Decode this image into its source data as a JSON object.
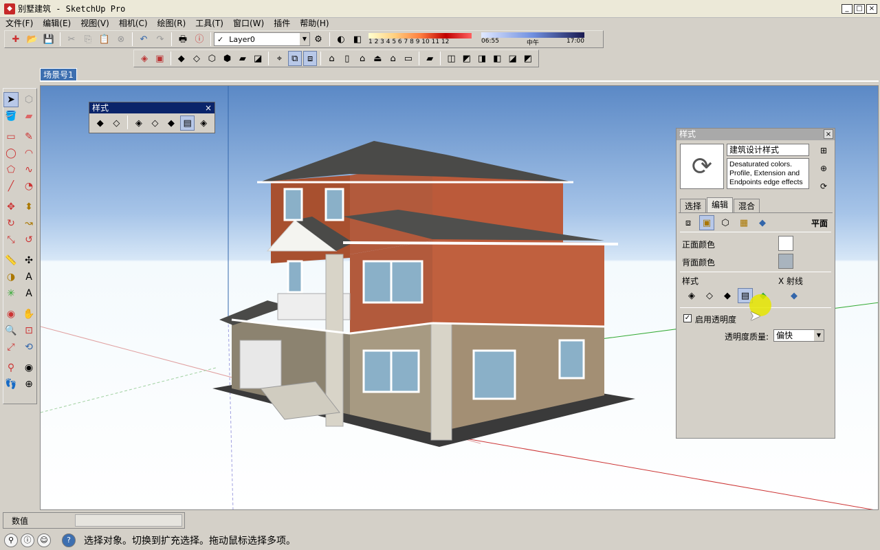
{
  "window": {
    "title": "别墅建筑 - SketchUp Pro",
    "app_icon": "sketchup-icon",
    "controls": {
      "minimize": "_",
      "maximize": "□",
      "close": "×"
    }
  },
  "menu": [
    "文件(F)",
    "编辑(E)",
    "视图(V)",
    "相机(C)",
    "绘图(R)",
    "工具(T)",
    "窗口(W)",
    "插件",
    "帮助(H)"
  ],
  "layer": {
    "checked": "✓",
    "value": "Layer0"
  },
  "shadow": {
    "months": "1 2 3 4 5 6 7 8 9 10 11 12",
    "time_start": "06:55",
    "time_mid": "中午",
    "time_end": "17:00"
  },
  "scene_tab": "场景号1",
  "styles_mini": {
    "title": "样式",
    "close": "×"
  },
  "styles_panel": {
    "title": "样式",
    "close": "×",
    "style_name": "建筑设计样式",
    "style_description": "Desaturated colors. Profile, Extension and Endpoints edge effects",
    "tabs": [
      "选择",
      "编辑",
      "混合"
    ],
    "active_tab": "编辑",
    "section_label": "平面",
    "front_color_label": "正面颜色",
    "front_color": "#ffffff",
    "back_color_label": "背面颜色",
    "back_color": "#a9b4be",
    "style_label": "样式",
    "xray_label": "X 射线",
    "enable_transparency": "启用透明度",
    "transparency_checked": "✓",
    "transparency_quality_label": "透明度质量:",
    "transparency_quality": "偏快"
  },
  "measurements": {
    "label": "数值",
    "value": ""
  },
  "status": {
    "message": "选择对象。切换到扩充选择。拖动鼠标选择多项。",
    "help": "?"
  },
  "accent": "#3d6fb0"
}
